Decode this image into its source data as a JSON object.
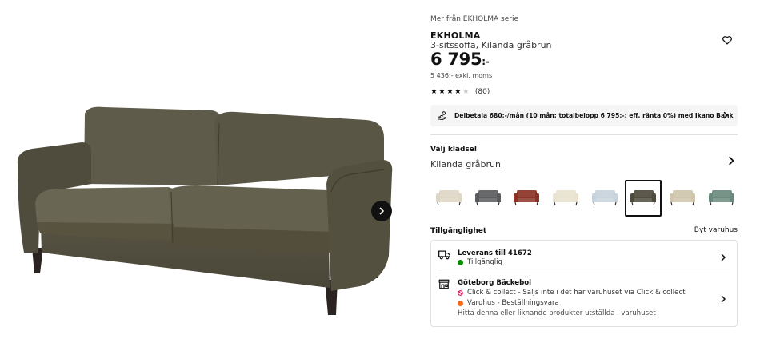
{
  "product": {
    "series_link": "Mer från EKHOLMA serie",
    "name": "EKHOLMA",
    "description": "3-sitssoffa, Kilanda gråbrun",
    "price_main": "6 795",
    "price_suffix": ":-",
    "price_ex_vat": "5 436:- exkl. moms",
    "rating": {
      "stars": 4,
      "max": 5,
      "count_label": "(80)"
    }
  },
  "finance": {
    "text": "Delbetala 680:-/mån (10 mån; totalbelopp 6 795:-; eff. ränta 0%) med Ikano Bank"
  },
  "upholstery": {
    "label": "Välj klädsel",
    "selected_name": "Kilanda gråbrun",
    "swatches": [
      {
        "color": "#ded6c4"
      },
      {
        "color": "#5a5c5e"
      },
      {
        "color": "#8a3324"
      },
      {
        "color": "#e8e2cf"
      },
      {
        "color": "#c7d3dc"
      },
      {
        "color": "#4e4a3c",
        "selected": true
      },
      {
        "color": "#cfc6ad"
      },
      {
        "color": "#6b8a7e"
      }
    ]
  },
  "availability": {
    "label": "Tillgänglighet",
    "change_store": "Byt varuhus",
    "delivery": {
      "title": "Leverans till 41672",
      "status": "Tillgänglig",
      "status_color": "#0a8a00"
    },
    "store": {
      "title": "Göteborg Bäckebol",
      "click_collect": "Click & collect - Säljs inte i det här varuhuset via Click & collect",
      "click_collect_color": "#e00751",
      "stock": "Varuhus - Beställningsvara",
      "stock_color": "#f26a1b",
      "note": "Hitta denna eller liknande produkter utställda i varuhuset"
    }
  },
  "icons": {
    "favorite": "heart-outline-icon",
    "next_image": "chevron-right-icon",
    "finance": "hand-coins-icon",
    "delivery": "truck-icon",
    "store": "store-icon"
  }
}
